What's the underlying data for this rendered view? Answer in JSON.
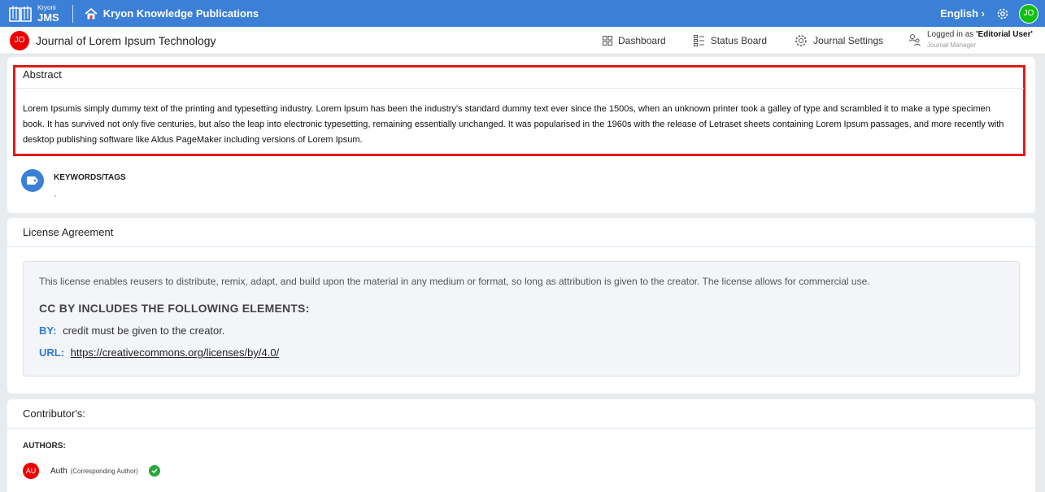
{
  "topbar": {
    "logo_small": "Kryoni",
    "logo_big": "JMS",
    "publisher": "Kryon Knowledge Publications",
    "language": "English",
    "user_initials": "JO"
  },
  "journalbar": {
    "journal_initials": "JO",
    "journal_title": "Journal of Lorem Ipsum Technology",
    "nav": {
      "dashboard": "Dashboard",
      "status_board": "Status Board",
      "journal_settings": "Journal Settings"
    },
    "logged_in_prefix": "Logged in as ",
    "logged_in_user": "'Editorial User'",
    "role": "Journal Manager"
  },
  "abstract": {
    "heading": "Abstract",
    "text": "Lorem Ipsumis simply dummy text of the printing and typesetting industry. Lorem Ipsum has been the industry's standard dummy text ever since the 1500s, when an unknown printer took a galley of type and scrambled it to make a type specimen book. It has survived not only five centuries, but also the leap into electronic typesetting, remaining essentially unchanged. It was popularised in the 1960s with the release of Letraset sheets containing Lorem Ipsum passages, and more recently with desktop publishing software like Aldus PageMaker including versions of Lorem Ipsum.",
    "keywords_label": "KEYWORDS/TAGS",
    "keywords_value": "-"
  },
  "license": {
    "heading": "License Agreement",
    "description": "This license enables reusers to distribute, remix, adapt, and build upon the material in any medium or format, so long as attribution is given to the creator. The license allows for commercial use.",
    "elements_title": "CC BY INCLUDES THE FOLLOWING ELEMENTS:",
    "by_key": "BY:",
    "by_value": "credit must be given to the creator.",
    "url_key": "URL:",
    "url_value": "https://creativecommons.org/licenses/by/4.0/"
  },
  "contributors": {
    "heading": "Contributor's:",
    "authors_label": "AUTHORS:",
    "authors": [
      {
        "initials": "AU",
        "name": "Auth",
        "role": "(Corresponding Author)"
      }
    ]
  },
  "colors": {
    "topbar": "#3b7fd6",
    "highlight_border": "#e01a1a",
    "avatar_red": "#e00000",
    "user_green": "#10c010",
    "verified_green": "#27a83a",
    "link_blue": "#2f7bd0"
  },
  "icons": [
    "book-logo-icon",
    "home-icon",
    "chevron-right-icon",
    "gear-icon",
    "grid-icon",
    "status-board-icon",
    "settings-cog-icon",
    "user-swap-icon",
    "tag-icon",
    "check-icon"
  ]
}
